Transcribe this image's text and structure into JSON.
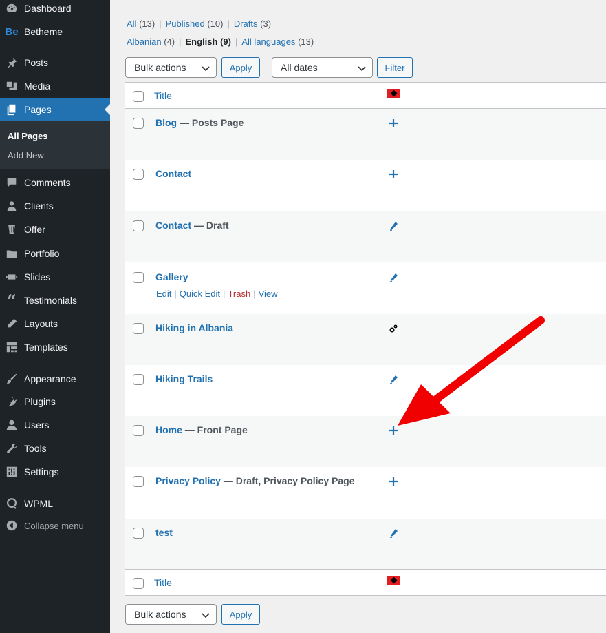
{
  "sidebar": {
    "menu": [
      {
        "label": "Dashboard",
        "icon": "dashboard-icon"
      },
      {
        "label": "Betheme",
        "icon": "betheme-logo-icon"
      },
      {
        "label": "Posts",
        "icon": "pin-icon"
      },
      {
        "label": "Media",
        "icon": "media-icon"
      },
      {
        "label": "Pages",
        "icon": "pages-icon"
      },
      {
        "label": "Comments",
        "icon": "comment-icon"
      },
      {
        "label": "Clients",
        "icon": "clients-icon"
      },
      {
        "label": "Offer",
        "icon": "offer-icon"
      },
      {
        "label": "Portfolio",
        "icon": "portfolio-icon"
      },
      {
        "label": "Slides",
        "icon": "slides-icon"
      },
      {
        "label": "Testimonials",
        "icon": "quote-icon"
      },
      {
        "label": "Layouts",
        "icon": "layouts-icon"
      },
      {
        "label": "Templates",
        "icon": "templates-icon"
      },
      {
        "label": "Appearance",
        "icon": "paintbrush-icon"
      },
      {
        "label": "Plugins",
        "icon": "plugin-icon"
      },
      {
        "label": "Users",
        "icon": "user-icon"
      },
      {
        "label": "Tools",
        "icon": "wrench-icon"
      },
      {
        "label": "Settings",
        "icon": "settings-icon"
      },
      {
        "label": "WPML",
        "icon": "wpml-icon"
      }
    ],
    "submenu": {
      "all_pages": "All Pages",
      "add_new": "Add New"
    },
    "collapse": "Collapse menu"
  },
  "views": {
    "all": "All",
    "all_count": "(13)",
    "published": "Published",
    "published_count": "(10)",
    "drafts": "Drafts",
    "drafts_count": "(3)"
  },
  "languages": {
    "albanian": "Albanian",
    "albanian_count": "(4)",
    "english": "English",
    "english_count": "(9)",
    "all": "All languages",
    "all_count": "(13)"
  },
  "toolbar": {
    "bulk_actions": "Bulk actions",
    "apply": "Apply",
    "all_dates": "All dates",
    "filter": "Filter"
  },
  "table": {
    "title_header": "Title",
    "rows": [
      {
        "title": "Blog",
        "state": " — Posts Page",
        "lang_icon": "plus-icon"
      },
      {
        "title": "Contact",
        "state": "",
        "lang_icon": "plus-icon"
      },
      {
        "title": "Contact",
        "state": " — Draft",
        "lang_icon": "pencil-icon"
      },
      {
        "title": "Gallery",
        "state": "",
        "lang_icon": "pencil-icon",
        "actions": {
          "edit": "Edit",
          "quick_edit": "Quick Edit",
          "trash": "Trash",
          "view": "View"
        }
      },
      {
        "title": "Hiking in Albania",
        "state": "",
        "lang_icon": "gears-icon"
      },
      {
        "title": "Hiking Trails",
        "state": "",
        "lang_icon": "pencil-icon"
      },
      {
        "title": "Home",
        "state": " — Front Page",
        "lang_icon": "plus-icon"
      },
      {
        "title": "Privacy Policy",
        "state": " — Draft, Privacy Policy Page",
        "lang_icon": "plus-icon"
      },
      {
        "title": "test",
        "state": "",
        "lang_icon": "pencil-icon"
      }
    ]
  },
  "colors": {
    "accent": "#2271b1",
    "sidebar_bg": "#1d2327",
    "arrow": "#f00000",
    "flag_red": "#e41e20"
  }
}
